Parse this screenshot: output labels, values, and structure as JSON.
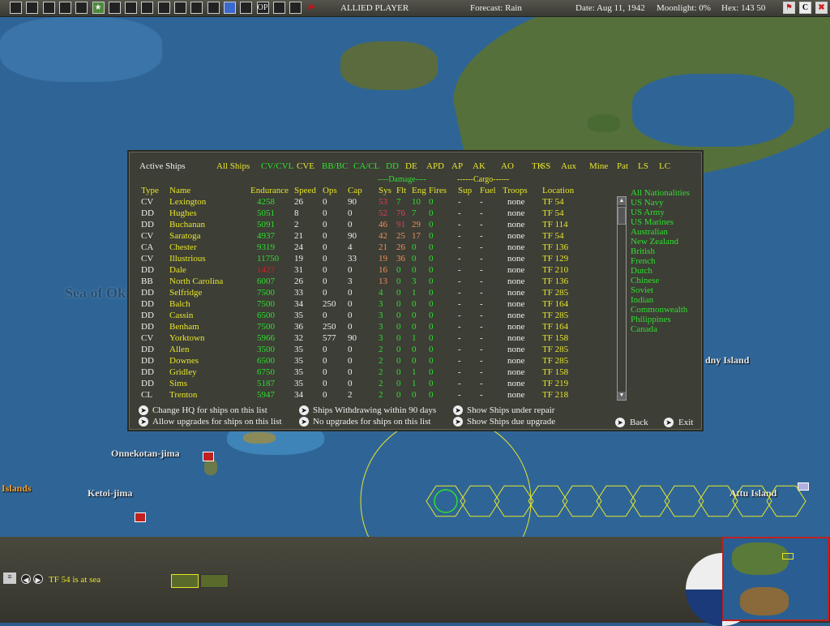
{
  "topbar": {
    "icons": [
      "save-icon",
      "report-icon",
      "ship-list-icon",
      "air-list-icon",
      "info-icon",
      "leader-icon",
      "air-japan-icon",
      "air-allied-icon",
      "flag-icon",
      "ship-icon",
      "sub-icon",
      "base-icon",
      "convoy-icon",
      "globe-icon",
      "target-icon",
      "op-icon",
      "transport-icon",
      "weather-icon",
      "end-turn-icon"
    ],
    "op_label": "OP",
    "player": "ALLIED PLAYER",
    "forecast": "Forecast: Rain",
    "date": "Date:  Aug 11, 1942",
    "moonlight": "Moonlight: 0%",
    "hex": "Hex: 143  50",
    "right_buttons": {
      "c_label": "C"
    }
  },
  "map": {
    "labels": {
      "sea": "Sea of Okhotsk",
      "onnekotan": "Onnekotan-jima",
      "ketoi": "Ketoi-jima",
      "islands": "Islands",
      "attu": "Attu Island",
      "dny": "dny Island"
    }
  },
  "panel": {
    "title": "Active Ships",
    "filters": [
      {
        "label": "All Ships",
        "color": "y"
      },
      {
        "label": "CV/CVL",
        "color": "g"
      },
      {
        "label": "CVE",
        "color": "y"
      },
      {
        "label": "BB/BC",
        "color": "g"
      },
      {
        "label": "CA/CL",
        "color": "g"
      },
      {
        "label": "DD",
        "color": "g"
      },
      {
        "label": "DE",
        "color": "y"
      },
      {
        "label": "APD",
        "color": "y"
      },
      {
        "label": "AP",
        "color": "y"
      },
      {
        "label": "AK",
        "color": "y"
      },
      {
        "label": "AO",
        "color": "y"
      },
      {
        "label": "TK",
        "color": "y"
      },
      {
        "label": "SS",
        "color": "y"
      },
      {
        "label": "Aux",
        "color": "y"
      },
      {
        "label": "Mine",
        "color": "y"
      },
      {
        "label": "Pat",
        "color": "y"
      },
      {
        "label": "LS",
        "color": "y"
      },
      {
        "label": "LC",
        "color": "y"
      }
    ],
    "group_damage": "----Damage----",
    "group_cargo": "------Cargo------",
    "columns": [
      "Type",
      "Name",
      "Endurance",
      "Speed",
      "Ops",
      "Cap",
      "Sys",
      "Flt",
      "Eng",
      "Fires",
      "Sup",
      "Fuel",
      "Troops",
      "Location"
    ],
    "rows": [
      [
        "CV",
        "Lexington",
        "4258",
        "26",
        "0",
        "90",
        "53",
        "7",
        "10",
        "0",
        "-",
        "-",
        "none",
        "TF 54"
      ],
      [
        "DD",
        "Hughes",
        "5051",
        "8",
        "0",
        "0",
        "52",
        "76",
        "7",
        "0",
        "-",
        "-",
        "none",
        "TF 54"
      ],
      [
        "DD",
        "Buchanan",
        "5091",
        "2",
        "0",
        "0",
        "46",
        "91",
        "29",
        "0",
        "-",
        "-",
        "none",
        "TF 114"
      ],
      [
        "CV",
        "Saratoga",
        "4937",
        "21",
        "0",
        "90",
        "42",
        "25",
        "17",
        "0",
        "-",
        "-",
        "none",
        "TF 54"
      ],
      [
        "CA",
        "Chester",
        "9319",
        "24",
        "0",
        "4",
        "21",
        "26",
        "0",
        "0",
        "-",
        "-",
        "none",
        "TF 136"
      ],
      [
        "CV",
        "Illustrious",
        "11750",
        "19",
        "0",
        "33",
        "19",
        "36",
        "0",
        "0",
        "-",
        "-",
        "none",
        "TF 129"
      ],
      [
        "DD",
        "Dale",
        "1427",
        "31",
        "0",
        "0",
        "16",
        "0",
        "0",
        "0",
        "-",
        "-",
        "none",
        "TF 210"
      ],
      [
        "BB",
        "North Carolina",
        "6007",
        "26",
        "0",
        "3",
        "13",
        "0",
        "3",
        "0",
        "-",
        "-",
        "none",
        "TF 136"
      ],
      [
        "DD",
        "Selfridge",
        "7500",
        "33",
        "0",
        "0",
        "4",
        "0",
        "1",
        "0",
        "-",
        "-",
        "none",
        "TF 285"
      ],
      [
        "DD",
        "Balch",
        "7500",
        "34",
        "250",
        "0",
        "3",
        "0",
        "0",
        "0",
        "-",
        "-",
        "none",
        "TF 164"
      ],
      [
        "DD",
        "Cassin",
        "6500",
        "35",
        "0",
        "0",
        "3",
        "0",
        "0",
        "0",
        "-",
        "-",
        "none",
        "TF 285"
      ],
      [
        "DD",
        "Benham",
        "7500",
        "36",
        "250",
        "0",
        "3",
        "0",
        "0",
        "0",
        "-",
        "-",
        "none",
        "TF 164"
      ],
      [
        "CV",
        "Yorktown",
        "5966",
        "32",
        "577",
        "90",
        "3",
        "0",
        "1",
        "0",
        "-",
        "-",
        "none",
        "TF 158"
      ],
      [
        "DD",
        "Allen",
        "3500",
        "35",
        "0",
        "0",
        "2",
        "0",
        "0",
        "0",
        "-",
        "-",
        "none",
        "TF 285"
      ],
      [
        "DD",
        "Downes",
        "6500",
        "35",
        "0",
        "0",
        "2",
        "0",
        "0",
        "0",
        "-",
        "-",
        "none",
        "TF 285"
      ],
      [
        "DD",
        "Gridley",
        "6750",
        "35",
        "0",
        "0",
        "2",
        "0",
        "1",
        "0",
        "-",
        "-",
        "none",
        "TF 158"
      ],
      [
        "DD",
        "Sims",
        "5187",
        "35",
        "0",
        "0",
        "2",
        "0",
        "1",
        "0",
        "-",
        "-",
        "none",
        "TF 219"
      ],
      [
        "CL",
        "Trenton",
        "5947",
        "34",
        "0",
        "2",
        "2",
        "0",
        "0",
        "0",
        "-",
        "-",
        "none",
        "TF 218"
      ]
    ],
    "low_endurance_ships": [
      "Dale"
    ],
    "nationalities": [
      "All Nationalities",
      "US Navy",
      "US Army",
      "US Marines",
      "Australian",
      "New Zealand",
      "British",
      "French",
      "Dutch",
      "Chinese",
      "Soviet",
      "Indian",
      "Commonwealth",
      "Philippines",
      "Canada"
    ],
    "actions": [
      "Change HQ for ships on this list",
      "Allow upgrades for ships on this list",
      "Ships Withdrawing within 90 days",
      "No upgrades for ships on this list",
      "Show Ships under repair",
      "Show Ships due upgrade"
    ],
    "back": "Back",
    "exit": "Exit",
    "colors": {
      "yellow": "#e6e62a",
      "green": "#2ee02e",
      "orange": "#f09058",
      "pink": "#e0405c",
      "red": "#d02020"
    }
  },
  "bottom": {
    "status": "TF 54 is at sea"
  }
}
